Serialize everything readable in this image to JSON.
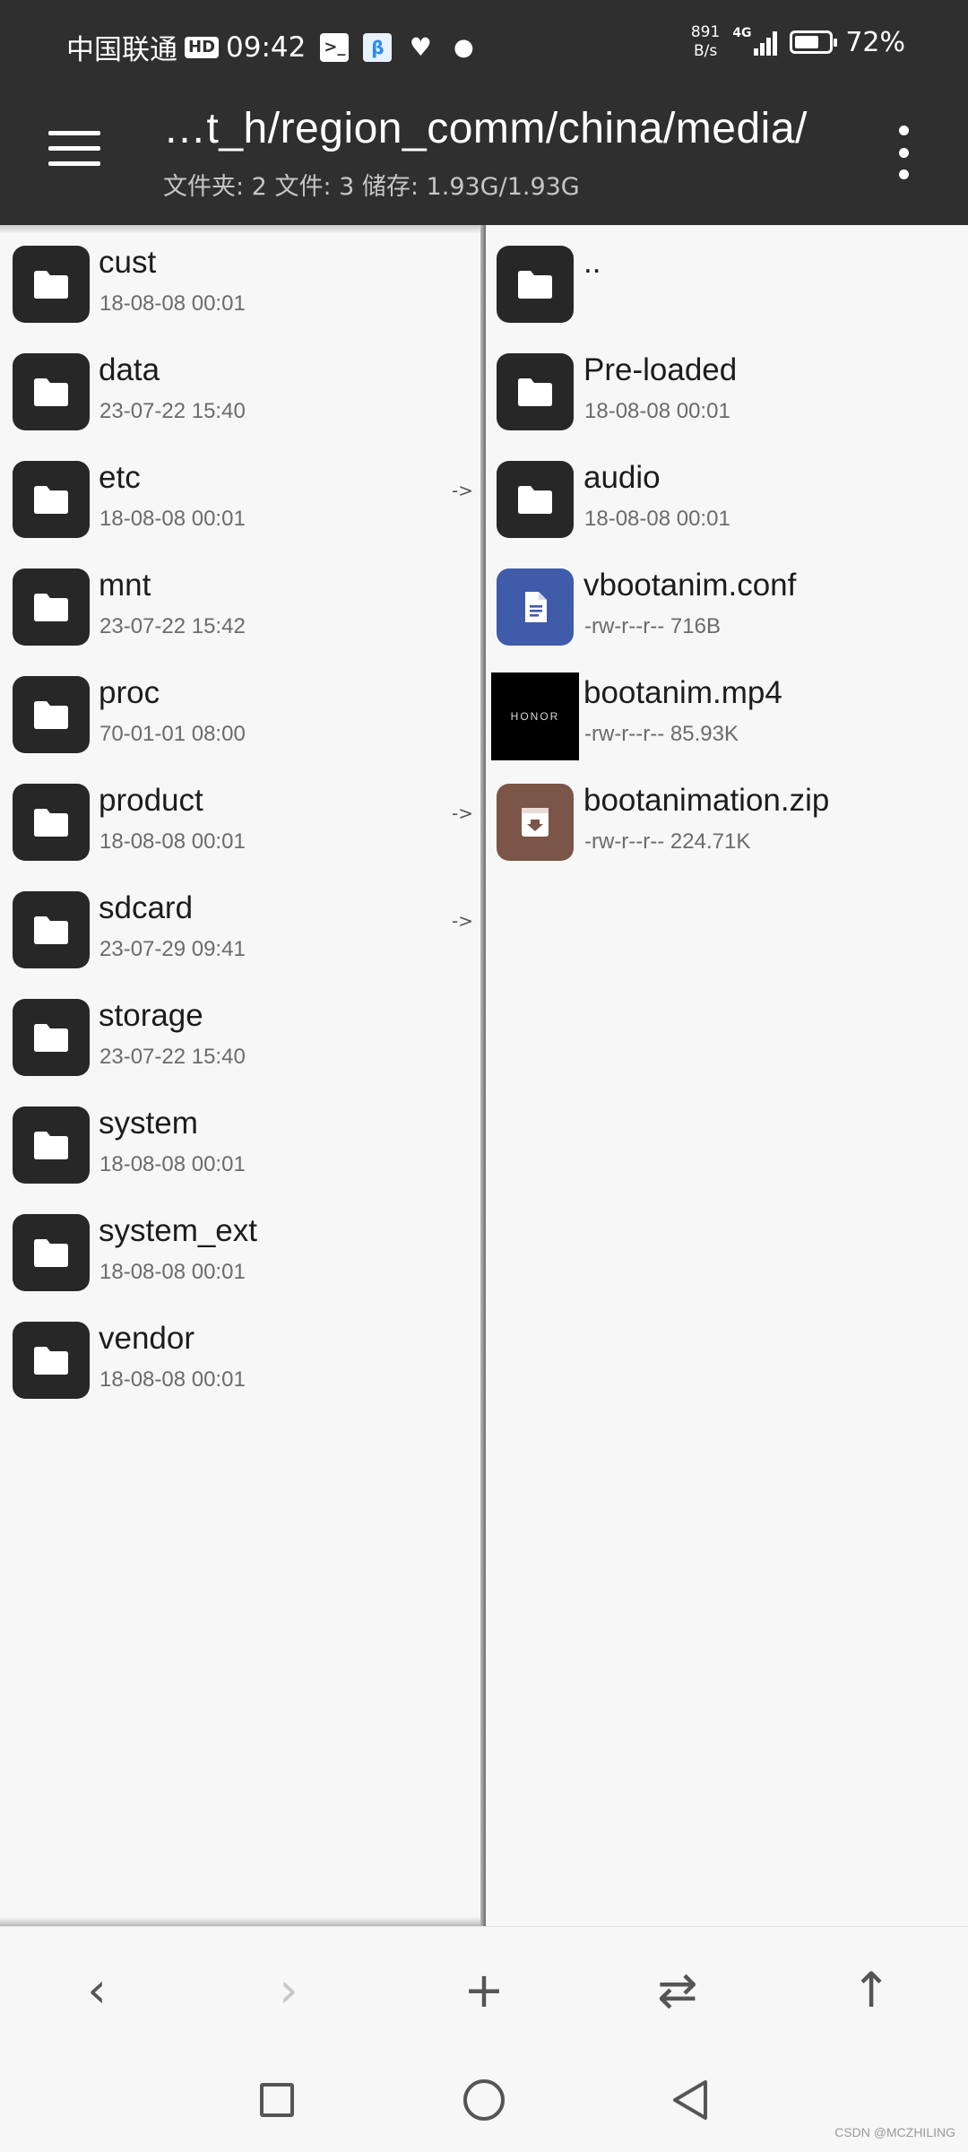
{
  "status_bar": {
    "carrier": "中国联通",
    "hd": "HD",
    "time": "09:42",
    "net_speed_value": "891",
    "net_speed_unit": "B/s",
    "network_type": "4G",
    "battery_percent": "72%",
    "battery_level": 0.72
  },
  "app_bar": {
    "path": "…t_h/region_comm/china/media/",
    "summary": "文件夹: 2  文件: 3  储存: 1.93G/1.93G"
  },
  "left_pane": {
    "items": [
      {
        "name": "cust",
        "meta": "18-08-08 00:01",
        "link": ""
      },
      {
        "name": "data",
        "meta": "23-07-22 15:40",
        "link": ""
      },
      {
        "name": "etc",
        "meta": "18-08-08 00:01",
        "link": "->"
      },
      {
        "name": "mnt",
        "meta": "23-07-22 15:42",
        "link": ""
      },
      {
        "name": "proc",
        "meta": "70-01-01 08:00",
        "link": ""
      },
      {
        "name": "product",
        "meta": "18-08-08 00:01",
        "link": "->"
      },
      {
        "name": "sdcard",
        "meta": "23-07-29 09:41",
        "link": "->"
      },
      {
        "name": "storage",
        "meta": "23-07-22 15:40",
        "link": ""
      },
      {
        "name": "system",
        "meta": "18-08-08 00:01",
        "link": ""
      },
      {
        "name": "system_ext",
        "meta": "18-08-08 00:01",
        "link": ""
      },
      {
        "name": "vendor",
        "meta": "18-08-08 00:01",
        "link": ""
      }
    ]
  },
  "right_pane": {
    "items": [
      {
        "name": "..",
        "meta": "",
        "type": "folder"
      },
      {
        "name": "Pre-loaded",
        "meta": "18-08-08 00:01",
        "type": "folder"
      },
      {
        "name": "audio",
        "meta": "18-08-08 00:01",
        "type": "folder"
      },
      {
        "name": "vbootanim.conf",
        "meta": "-rw-r--r--   716B",
        "type": "doc"
      },
      {
        "name": "bootanim.mp4",
        "meta": "-rw-r--r--   85.93K",
        "type": "video",
        "thumb_text": "HONOR"
      },
      {
        "name": "bootanimation.zip",
        "meta": "-rw-r--r--   224.71K",
        "type": "zip"
      }
    ]
  },
  "toolbar": {
    "back_icon": "‹",
    "forward_icon": "›",
    "add_icon": "+",
    "swap_icon": "⇄",
    "up_icon": "↑"
  },
  "watermark": "CSDN @MCZHILING"
}
